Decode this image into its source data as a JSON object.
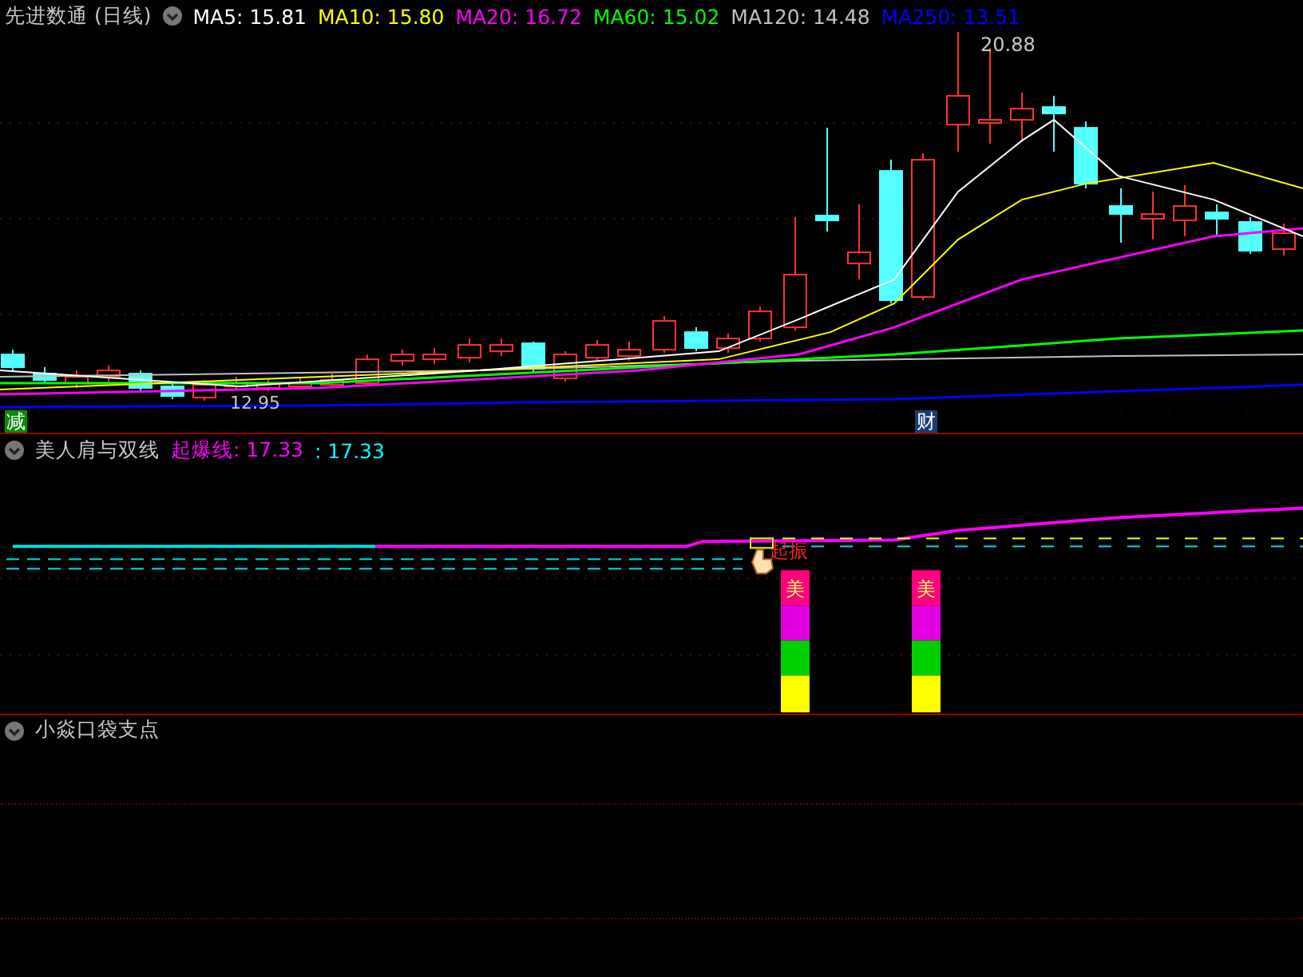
{
  "price_panel": {
    "title": "先进数通 (日线)",
    "indicators": [
      {
        "label": "MA5: 15.81",
        "color": "#ffffff"
      },
      {
        "label": "MA10: 15.80",
        "color": "#ffff00"
      },
      {
        "label": "MA20: 16.72",
        "color": "#ff00ff"
      },
      {
        "label": "MA60: 15.02",
        "color": "#00ff00"
      },
      {
        "label": "MA120: 14.48",
        "color": "#c0c0c0"
      },
      {
        "label": "MA250: 13.51",
        "color": "#0000ff"
      }
    ],
    "high_label": "20.88",
    "low_label": "12.95",
    "markers": [
      {
        "text": "减",
        "color": "#0a8a0a"
      },
      {
        "text": "财",
        "color": "#1a3d70"
      }
    ]
  },
  "signal_panel": {
    "title": "美人肩与双线",
    "values": [
      {
        "label": "起爆线: 17.33",
        "color": "#ff00ff"
      },
      {
        "label": ": 17.33",
        "color": "#00ffff"
      }
    ],
    "signal_label": "起振",
    "bars": [
      {
        "text": "美"
      },
      {
        "text": "美"
      }
    ]
  },
  "pivot_panel": {
    "title": "小焱口袋支点"
  }
}
